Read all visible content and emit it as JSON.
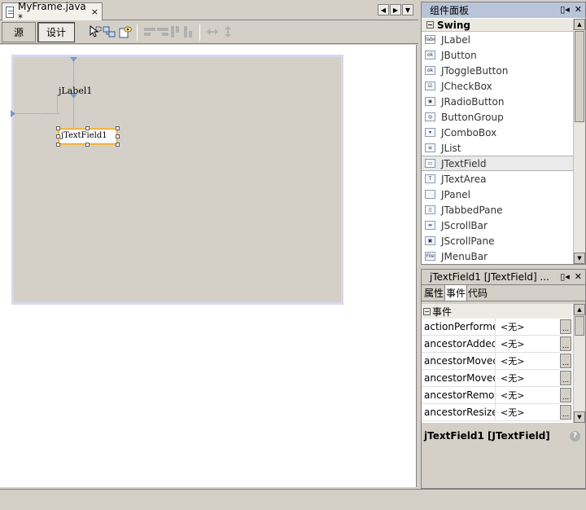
{
  "editor": {
    "file_tab": {
      "title": "MyFrame.java *",
      "close": "×"
    },
    "nav": {
      "left": "◀",
      "right": "▶",
      "menu": "▼"
    },
    "view_buttons": {
      "source": "源",
      "design": "设计"
    },
    "form": {
      "label_text": "jLabel1",
      "textfield_text": "jTextField1"
    }
  },
  "palette": {
    "title": "组件面板",
    "header_controls": {
      "minimize": "▯◂",
      "close": "✕"
    },
    "category": {
      "toggle": "−",
      "name": "Swing"
    },
    "items": [
      {
        "label": "JLabel",
        "icon": "label"
      },
      {
        "label": "JButton",
        "icon": "ok"
      },
      {
        "label": "JToggleButton",
        "icon": "ok"
      },
      {
        "label": "JCheckBox",
        "icon": "☑"
      },
      {
        "label": "JRadioButton",
        "icon": "◉"
      },
      {
        "label": "ButtonGroup",
        "icon": "◎"
      },
      {
        "label": "JComboBox",
        "icon": "▾"
      },
      {
        "label": "JList",
        "icon": "≡"
      },
      {
        "label": "JTextField",
        "icon": "▭"
      },
      {
        "label": "JTextArea",
        "icon": "T"
      },
      {
        "label": "JPanel",
        "icon": ""
      },
      {
        "label": "JTabbedPane",
        "icon": "▯"
      },
      {
        "label": "JScrollBar",
        "icon": "⇹"
      },
      {
        "label": "JScrollPane",
        "icon": "▣"
      },
      {
        "label": "JMenuBar",
        "icon": "File"
      }
    ],
    "selected_item": "JTextField"
  },
  "properties": {
    "title": "jTextField1 [JTextField] ...",
    "header_controls": {
      "minimize": "▯◂",
      "close": "✕"
    },
    "tabs": [
      "属性",
      "事件",
      "代码"
    ],
    "active_tab": "事件",
    "category": {
      "toggle": "−",
      "name": "事件"
    },
    "events": [
      {
        "name": "actionPerformed",
        "value": "<无>"
      },
      {
        "name": "ancestorAdded",
        "value": "<无>"
      },
      {
        "name": "ancestorMoved",
        "value": "<无>"
      },
      {
        "name": "ancestorMoved",
        "value": "<无>"
      },
      {
        "name": "ancestorRemoved",
        "value": "<无>"
      },
      {
        "name": "ancestorResized",
        "value": "<无>"
      }
    ],
    "ellipsis": "...",
    "description": "jTextField1 [JTextField]",
    "help": "?"
  },
  "colors": {
    "chrome": "#d4d0c8",
    "palette_header": "#b8c4d8",
    "selection_border": "#e8a020",
    "guide": "#7a9ac8"
  }
}
